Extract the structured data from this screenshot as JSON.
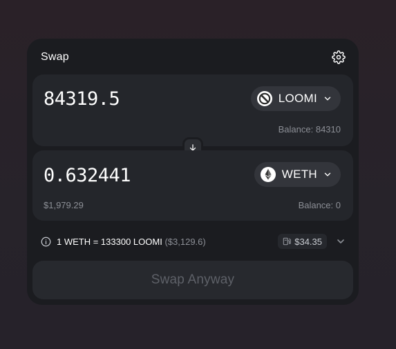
{
  "header": {
    "title": "Swap",
    "settings_icon": "gear-icon"
  },
  "from": {
    "amount": "84319.5",
    "token": "LOOMI",
    "token_icon": "loomi-token-icon",
    "balance": "Balance: 84310"
  },
  "to": {
    "amount": "0.632441",
    "token": "WETH",
    "token_icon": "ethereum-token-icon",
    "usd_value": "$1,979.29",
    "balance": "Balance: 0"
  },
  "switch_icon": "arrow-down-icon",
  "rate": {
    "text": "1 WETH = 133300 LOOMI",
    "usd": "($3,129.6)",
    "gas": "$34.35",
    "gas_icon": "gas-pump-icon"
  },
  "action": {
    "label": "Swap Anyway",
    "disabled": true
  },
  "colors": {
    "background": "#28222a",
    "card": "#1b1c20",
    "panel": "#24262b",
    "token_button": "#33353b",
    "muted_text": "#8c8f96",
    "disabled_text": "#5e6168"
  }
}
